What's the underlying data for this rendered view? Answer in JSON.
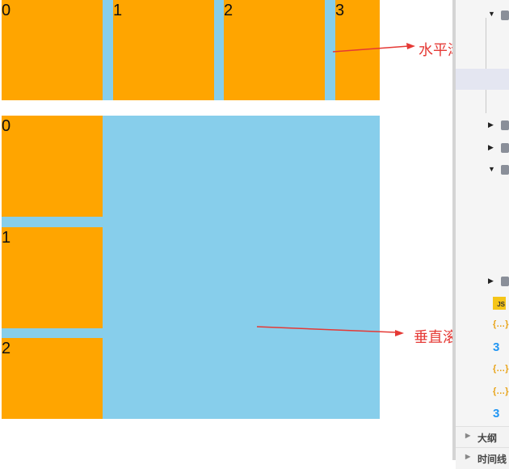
{
  "horizontal_scroll": {
    "items": [
      "0",
      "1",
      "2",
      "3"
    ]
  },
  "vertical_scroll": {
    "items": [
      "0",
      "1",
      "2"
    ]
  },
  "annotations": {
    "horizontal": "水平滚动",
    "vertical": "垂直滚动"
  },
  "explorer": {
    "icons": [
      "folder-icon",
      "file-js-icon",
      "file-json-icon",
      "file-css-icon"
    ],
    "file_badges": {
      "js": "JS",
      "json": "{…}",
      "css": "3"
    }
  },
  "bottom_panels": {
    "outline": "大纲",
    "timeline": "时间线"
  },
  "colors": {
    "item": "#ffa500",
    "container": "#87ceeb",
    "annotation": "#e53935"
  }
}
